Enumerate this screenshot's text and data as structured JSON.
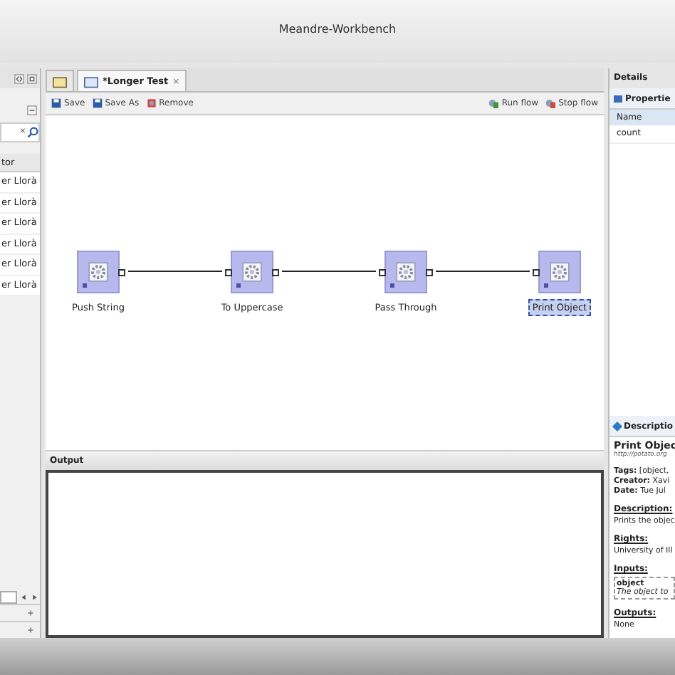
{
  "window": {
    "title": "Meandre-Workbench"
  },
  "left_panel": {
    "search": {
      "clear": "×"
    },
    "column_header": "tor",
    "rows": [
      "er Llorà",
      "er Llorà",
      "er Llorà",
      "er Llorà",
      "er Llorà",
      "er Llorà"
    ]
  },
  "editor": {
    "tabs": [
      {
        "kind": "icon",
        "selected": false
      },
      {
        "kind": "text",
        "label": "*Longer Test",
        "close": "×",
        "selected": true
      }
    ],
    "toolbar": {
      "left": [
        "Save",
        "Save As",
        "Remove"
      ],
      "right": [
        "Run flow",
        "Stop flow"
      ]
    },
    "nodes": [
      {
        "label": "Push String",
        "selected": false
      },
      {
        "label": "To Uppercase",
        "selected": false
      },
      {
        "label": "Pass Through",
        "selected": false
      },
      {
        "label": "Print Object",
        "selected": true
      }
    ]
  },
  "output": {
    "title": "Output"
  },
  "details": {
    "title": "Details",
    "properties_tab": "Propertie",
    "columns": [
      "Name"
    ],
    "rows": [
      "count"
    ],
    "description_tab": "Descriptio",
    "component": {
      "name": "Print Objec",
      "url": "http://potato.org",
      "meta": [
        "**Tags:** [object,",
        "**Creator:** Xavi",
        "**Date:** Tue Jul"
      ],
      "sections": [
        {
          "heading": "Description:",
          "text": "Prints the objec"
        },
        {
          "heading": "Rights:",
          "text": "University of Ill"
        },
        {
          "heading": "Inputs:",
          "port": "object",
          "port_text": "The object to"
        },
        {
          "heading": "Outputs:",
          "text": "None"
        }
      ]
    }
  }
}
